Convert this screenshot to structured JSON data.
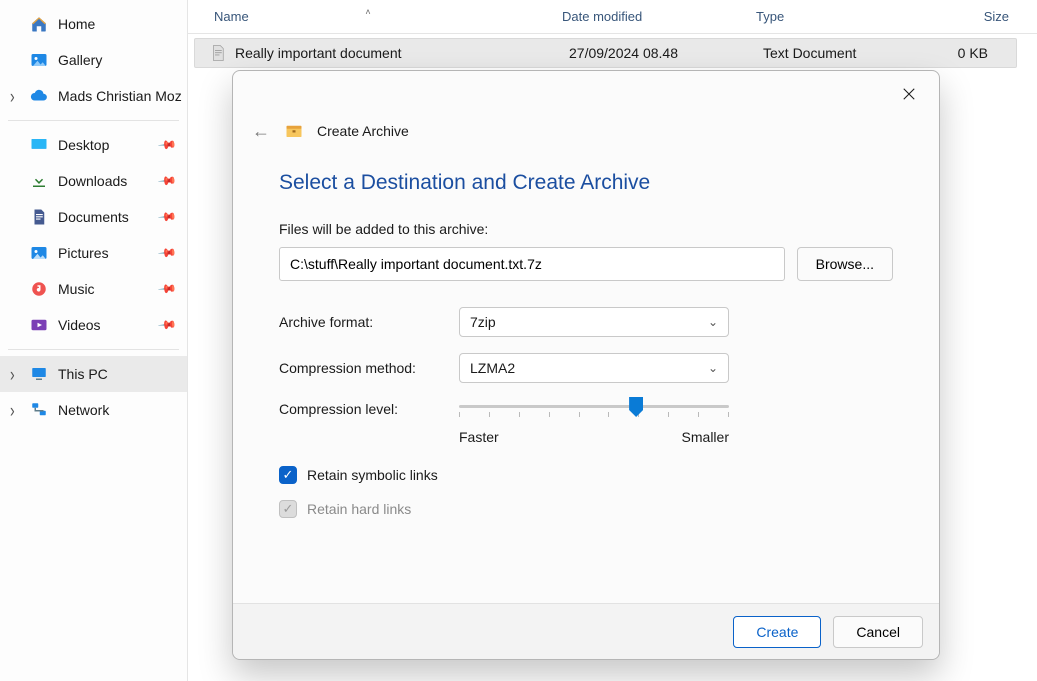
{
  "sidebar": {
    "home": "Home",
    "gallery": "Gallery",
    "onedrive": "Mads Christian Moz",
    "desktop": "Desktop",
    "downloads": "Downloads",
    "documents": "Documents",
    "pictures": "Pictures",
    "music": "Music",
    "videos": "Videos",
    "this_pc": "This PC",
    "network": "Network"
  },
  "columns": {
    "name": "Name",
    "date": "Date modified",
    "type": "Type",
    "size": "Size"
  },
  "files": [
    {
      "name": "Really important document",
      "date": "27/09/2024 08.48",
      "type": "Text Document",
      "size": "0 KB"
    }
  ],
  "dialog": {
    "header": "Create Archive",
    "title": "Select a Destination and Create Archive",
    "files_label": "Files will be added to this archive:",
    "path_value": "C:\\stuff\\Really important document.txt.7z",
    "browse": "Browse...",
    "archive_format_label": "Archive format:",
    "archive_format_value": "7zip",
    "compression_method_label": "Compression method:",
    "compression_method_value": "LZMA2",
    "compression_level_label": "Compression level:",
    "slider_faster": "Faster",
    "slider_smaller": "Smaller",
    "retain_symlinks": "Retain symbolic links",
    "retain_hardlinks": "Retain hard links",
    "create": "Create",
    "cancel": "Cancel"
  }
}
